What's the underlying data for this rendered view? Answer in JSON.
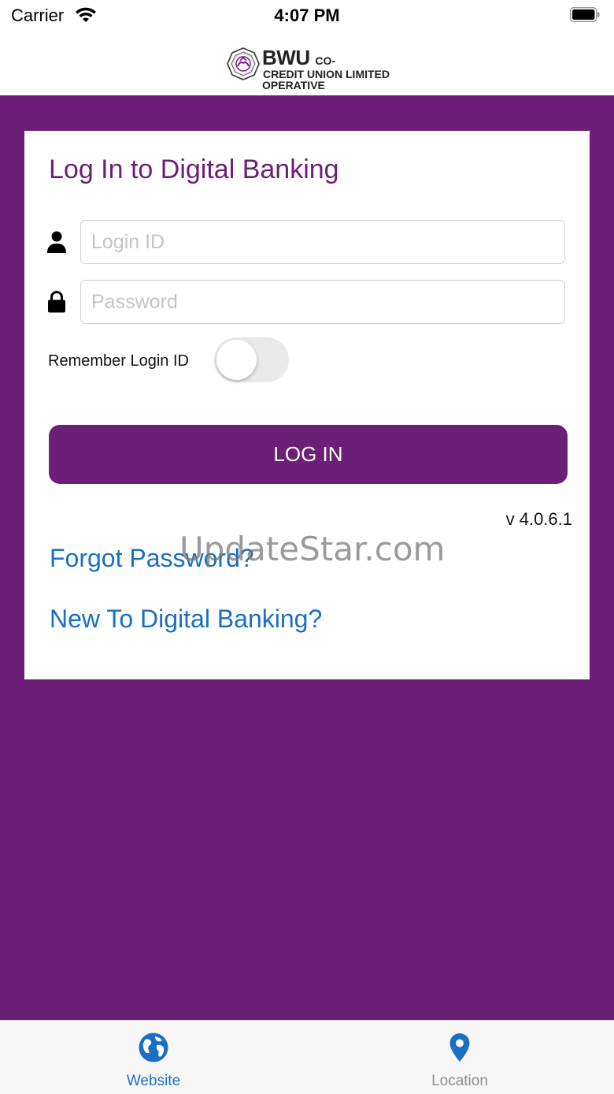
{
  "status_bar": {
    "carrier": "Carrier",
    "time": "4:07 PM"
  },
  "header": {
    "logo_brand": "BWU",
    "logo_suffix": "CO-OPERATIVE",
    "logo_line2": "CREDIT UNION LIMITED"
  },
  "login": {
    "title": "Log In to Digital Banking",
    "login_id_placeholder": "Login ID",
    "password_placeholder": "Password",
    "remember_label": "Remember Login ID",
    "remember_enabled": false,
    "button_label": "LOG IN",
    "version": "v 4.0.6.1",
    "forgot_password": "Forgot Password?",
    "new_to_banking": "New To Digital Banking?"
  },
  "watermark": "UpdateStar.com",
  "tab_bar": {
    "items": [
      {
        "label": "Website",
        "icon": "globe-icon",
        "active": true
      },
      {
        "label": "Location",
        "icon": "map-pin-icon",
        "active": false
      }
    ]
  },
  "colors": {
    "brand_purple": "#6c1f77",
    "link_blue": "#1a6fc2",
    "tab_active": "#1a6fc2",
    "tab_inactive": "#8e8e93"
  }
}
